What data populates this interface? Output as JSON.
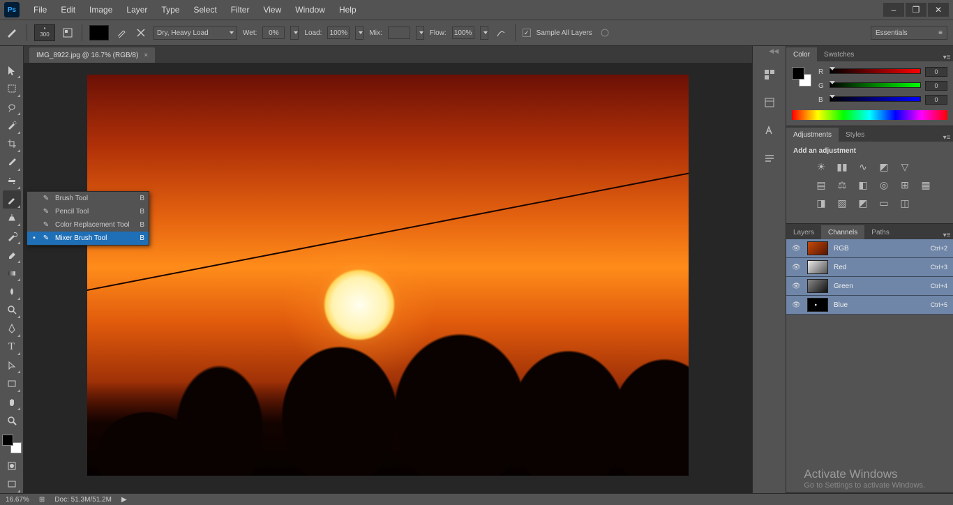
{
  "app": {
    "logo": "Ps",
    "workspace": "Essentials"
  },
  "menu": [
    "File",
    "Edit",
    "Image",
    "Layer",
    "Type",
    "Select",
    "Filter",
    "View",
    "Window",
    "Help"
  ],
  "options": {
    "brush_size": "300",
    "mode_label": "Dry, Heavy Load",
    "wet_label": "Wet:",
    "wet_val": "0%",
    "load_label": "Load:",
    "load_val": "100%",
    "mix_label": "Mix:",
    "mix_val": "",
    "flow_label": "Flow:",
    "flow_val": "100%",
    "sample_label": "Sample All Layers"
  },
  "doc": {
    "tab": "IMG_8922.jpg @ 16.7% (RGB/8)"
  },
  "flyout": [
    {
      "label": "Brush Tool",
      "shortcut": "B"
    },
    {
      "label": "Pencil Tool",
      "shortcut": "B"
    },
    {
      "label": "Color Replacement Tool",
      "shortcut": "B"
    },
    {
      "label": "Mixer Brush Tool",
      "shortcut": "B"
    }
  ],
  "flyout_selected": 3,
  "panels": {
    "color_tabs": [
      "Color",
      "Swatches"
    ],
    "rgb": {
      "r": "0",
      "g": "0",
      "b": "0"
    },
    "adj_tabs": [
      "Adjustments",
      "Styles"
    ],
    "adj_title": "Add an adjustment",
    "chan_tabs": [
      "Layers",
      "Channels",
      "Paths"
    ],
    "channels": [
      {
        "name": "RGB",
        "sc": "Ctrl+2",
        "thumb": "linear-gradient(135deg,#c24a0a,#5a1402)"
      },
      {
        "name": "Red",
        "sc": "Ctrl+3",
        "thumb": "linear-gradient(135deg,#e8e8e8,#555)"
      },
      {
        "name": "Green",
        "sc": "Ctrl+4",
        "thumb": "linear-gradient(135deg,#888,#111)"
      },
      {
        "name": "Blue",
        "sc": "Ctrl+5",
        "thumb": "radial-gradient(circle at 40% 50%,#fff 0 6%,#000 8%)"
      }
    ]
  },
  "status": {
    "zoom": "16.67%",
    "doc": "Doc: 51.3M/51.2M"
  },
  "activate": {
    "title": "Activate Windows",
    "sub": "Go to Settings to activate Windows."
  }
}
